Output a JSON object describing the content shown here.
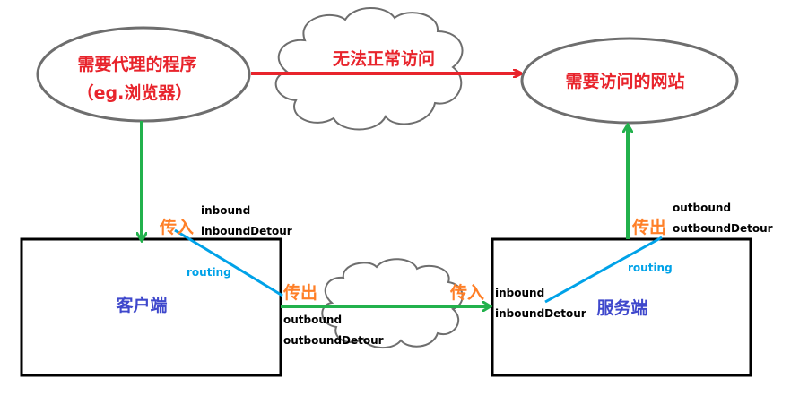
{
  "colors": {
    "red": "#e8242c",
    "green": "#22b14c",
    "orange": "#ff7f27",
    "blue": "#3f48cc",
    "routing": "#00a2e8",
    "black": "#000000",
    "ellipse_fill": "#ffffff",
    "ellipse_stroke": "#6e6e6e"
  },
  "app": {
    "line1": "需要代理的程序",
    "line2": "（eg.浏览器）"
  },
  "website": {
    "label": "需要访问的网站"
  },
  "blocked": {
    "label": "无法正常访问"
  },
  "client": {
    "label": "客户端",
    "in_label": "传入",
    "inbound": "inbound",
    "inbound_detour": "inboundDetour",
    "routing": "routing",
    "out_label": "传出",
    "outbound": "outbound",
    "outbound_detour": "outboundDetour"
  },
  "server": {
    "label": "服务端",
    "in_label": "传入",
    "inbound": "inbound",
    "inbound_detour": "inboundDetour",
    "routing": "routing",
    "out_label": "传出",
    "outbound": "outbound",
    "outbound_detour": "outboundDetour"
  },
  "icons": [
    "cloud-icon",
    "arrow-icon"
  ]
}
